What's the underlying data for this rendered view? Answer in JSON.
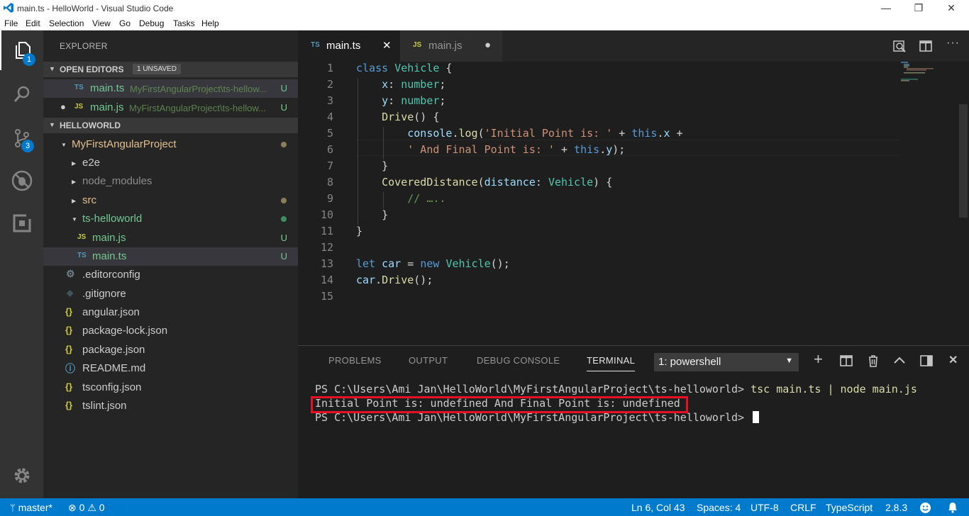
{
  "window": {
    "title": "main.ts - HelloWorld - Visual Studio Code",
    "minimize": "—",
    "maximize": "❐",
    "close": "✕"
  },
  "menu": [
    "File",
    "Edit",
    "Selection",
    "View",
    "Go",
    "Debug",
    "Tasks",
    "Help"
  ],
  "activity": {
    "explorer_badge": "1",
    "scm_badge": "3"
  },
  "sidebar": {
    "title": "EXPLORER",
    "open_editors": {
      "label": "OPEN EDITORS",
      "badge": "1 UNSAVED",
      "items": [
        {
          "icon": "TS",
          "name": "main.ts",
          "path": "MyFirstAngularProject\\ts-hellow...",
          "status": "U"
        },
        {
          "icon": "JS",
          "name": "main.js",
          "path": "MyFirstAngularProject\\ts-hellow...",
          "status": "U",
          "dirty": "●"
        }
      ]
    },
    "workspace": {
      "label": "HELLOWORLD",
      "project": "MyFirstAngularProject",
      "folders": {
        "e2e": "e2e",
        "node_modules": "node_modules",
        "src": "src",
        "ts_helloworld": "ts-helloworld"
      },
      "ts_files": [
        {
          "icon": "JS",
          "name": "main.js",
          "status": "U"
        },
        {
          "icon": "TS",
          "name": "main.ts",
          "status": "U"
        }
      ],
      "files": [
        {
          "icon": "⚙",
          "name": ".editorconfig"
        },
        {
          "icon": "◆",
          "name": ".gitignore"
        },
        {
          "icon": "{}",
          "name": "angular.json"
        },
        {
          "icon": "{}",
          "name": "package-lock.json"
        },
        {
          "icon": "{}",
          "name": "package.json"
        },
        {
          "icon": "ⓘ",
          "name": "README.md"
        },
        {
          "icon": "{}",
          "name": "tsconfig.json"
        },
        {
          "icon": "{}",
          "name": "tslint.json"
        }
      ]
    }
  },
  "tabs": [
    {
      "icon": "TS",
      "name": "main.ts",
      "action": "✕"
    },
    {
      "icon": "JS",
      "name": "main.js",
      "action": "●"
    }
  ],
  "editor": {
    "line_numbers": [
      "1",
      "2",
      "3",
      "4",
      "5",
      "6",
      "7",
      "8",
      "9",
      "10",
      "11",
      "12",
      "13",
      "14",
      "15"
    ]
  },
  "panel": {
    "tabs": [
      "PROBLEMS",
      "OUTPUT",
      "DEBUG CONSOLE",
      "TERMINAL"
    ],
    "terminal_select": "1: powershell",
    "terminal": {
      "line1_prompt": "PS C:\\Users\\Ami Jan\\HelloWorld\\MyFirstAngularProject\\ts-helloworld> ",
      "line1_cmd": "tsc main.ts | node main.js",
      "line2": "Initial Point is: undefined And Final Point is: undefined",
      "line3_prompt": "PS C:\\Users\\Ami Jan\\HelloWorld\\MyFirstAngularProject\\ts-helloworld> "
    }
  },
  "statusbar": {
    "branch": "master*",
    "errors": "0",
    "warnings": "0",
    "position": "Ln 6, Col 43",
    "spaces": "Spaces: 4",
    "encoding": "UTF-8",
    "eol": "CRLF",
    "language": "TypeScript",
    "version": "2.8.3"
  },
  "colors": {
    "accent": "#007acc",
    "ts_icon": "#519aba",
    "js_icon": "#cbcb41",
    "untracked": "#73c991",
    "highlight_box": "#e81123"
  }
}
